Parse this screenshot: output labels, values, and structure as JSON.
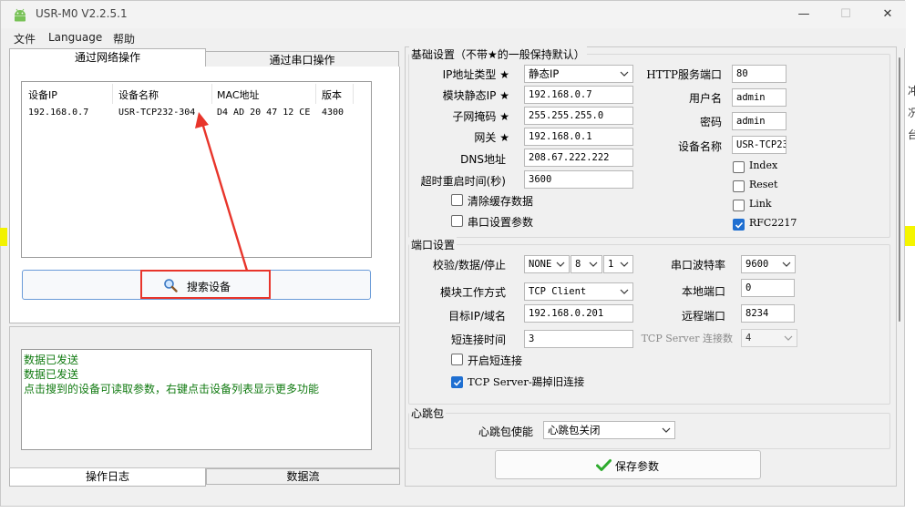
{
  "window": {
    "title": "USR-M0 V2.2.5.1",
    "minimize": "—",
    "maximize": "☐",
    "close": "✕"
  },
  "menu": [
    "文件",
    "Language",
    "帮助"
  ],
  "left": {
    "tabs": [
      "通过网络操作",
      "通过串口操作"
    ],
    "table": {
      "headers": [
        "设备IP",
        "设备名称",
        "MAC地址",
        "版本"
      ],
      "rows": [
        [
          "192.168.0.7",
          "USR-TCP232-304",
          "D4 AD 20 47 12 CE",
          "4300"
        ]
      ]
    },
    "search_button": "搜索设备",
    "log_lines": [
      "数据已发送",
      "数据已发送",
      "点击搜到的设备可读取参数，右键点击设备列表显示更多功能"
    ],
    "bottom_tabs": [
      "操作日志",
      "数据流"
    ]
  },
  "basic": {
    "title": "基础设置（不带★的一般保持默认）",
    "ip_type": {
      "label": "IP地址类型",
      "star": "★",
      "value": "静态IP"
    },
    "static_ip": {
      "label": "模块静态IP",
      "star": "★",
      "value": "192.168.0.7"
    },
    "subnet": {
      "label": "子网掩码",
      "star": "★",
      "value": "255.255.255.0"
    },
    "gateway": {
      "label": "网关",
      "star": "★",
      "value": "192.168.0.1"
    },
    "dns": {
      "label": "DNS地址",
      "value": "208.67.222.222"
    },
    "timeout": {
      "label": "超时重启时间(秒)",
      "value": "3600"
    },
    "clear_cache": {
      "label": "清除缓存数据",
      "checked": false
    },
    "serial_params": {
      "label": "串口设置参数",
      "checked": false
    },
    "http_port": {
      "label": "HTTP服务端口",
      "value": "80"
    },
    "username": {
      "label": "用户名",
      "value": "admin"
    },
    "password": {
      "label": "密码",
      "value": "admin"
    },
    "device_name": {
      "label": "设备名称",
      "value": "USR-TCP23"
    },
    "index": {
      "label": "Index",
      "checked": false
    },
    "reset": {
      "label": "Reset",
      "checked": false
    },
    "link": {
      "label": "Link",
      "checked": false
    },
    "rfc2217": {
      "label": "RFC2217",
      "checked": true
    }
  },
  "port": {
    "title": "端口设置",
    "parity_label": "校验/数据/停止",
    "parity": "NONE",
    "databits": "8",
    "stopbits": "1",
    "baud": {
      "label": "串口波特率",
      "value": "9600"
    },
    "mode": {
      "label": "模块工作方式",
      "value": "TCP Client"
    },
    "local_port": {
      "label": "本地端口",
      "value": "0"
    },
    "target": {
      "label": "目标IP/域名",
      "value": "192.168.0.201"
    },
    "remote_port": {
      "label": "远程端口",
      "value": "8234"
    },
    "short_time": {
      "label": "短连接时间",
      "value": "3"
    },
    "server_conn": {
      "label": "TCP Server 连接数",
      "value": "4"
    },
    "short_enable": {
      "label": "开启短连接",
      "checked": false
    },
    "kick_old": {
      "label": "TCP Server-踢掉旧连接",
      "checked": true
    }
  },
  "heartbeat": {
    "title": "心跳包",
    "enable": {
      "label": "心跳包使能",
      "value": "心跳包关闭"
    }
  },
  "save_button": "保存参数",
  "right_edge": [
    "冲",
    "况",
    "台"
  ],
  "colors": {
    "accent": "#1f6fd1",
    "annotation": "#e8352b",
    "log_text": "#107a10",
    "highlight": "#f5f500"
  }
}
